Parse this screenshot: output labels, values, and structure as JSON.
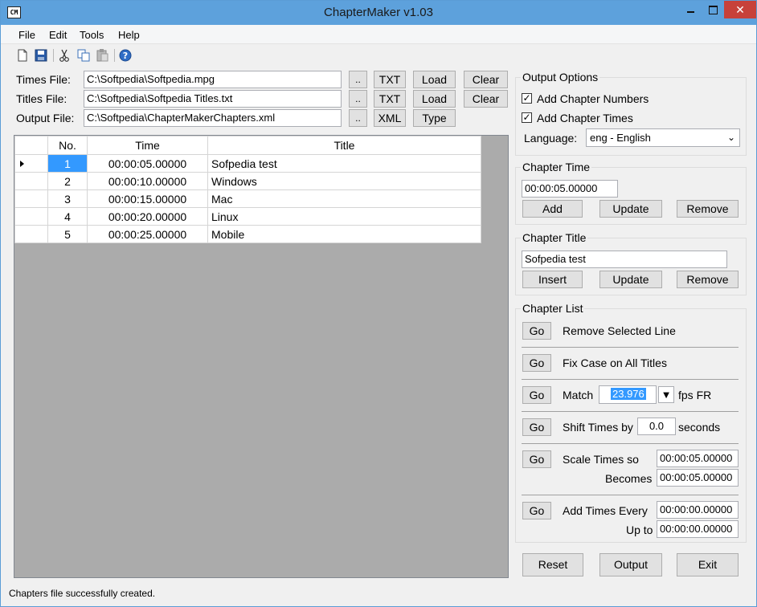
{
  "window": {
    "title": "ChapterMaker v1.03",
    "icon_label": "CM",
    "close_glyph": "✕"
  },
  "menu": [
    "File",
    "Edit",
    "Tools",
    "Help"
  ],
  "toolbar": {
    "icons": [
      "new-file-icon",
      "save-icon",
      "cut-icon",
      "copy-icon",
      "paste-icon",
      "help-icon"
    ]
  },
  "files": {
    "times_label": "Times File:",
    "times_value": "C:\\Softpedia\\Softpedia.mpg",
    "titles_label": "Titles File:",
    "titles_value": "C:\\Softpedia\\Softpedia Titles.txt",
    "output_label": "Output File:",
    "output_value": "C:\\Softpedia\\ChapterMakerChapters.xml",
    "browse_label": "..",
    "txt_label": "TXT",
    "xml_label": "XML",
    "load_label": "Load",
    "clear_label": "Clear",
    "type_label": "Type"
  },
  "grid": {
    "columns": [
      "No.",
      "Time",
      "Title"
    ],
    "rows": [
      {
        "no": "1",
        "time": "00:00:05.00000",
        "title": "Sofpedia test"
      },
      {
        "no": "2",
        "time": "00:00:10.00000",
        "title": "Windows"
      },
      {
        "no": "3",
        "time": "00:00:15.00000",
        "title": "Mac"
      },
      {
        "no": "4",
        "time": "00:00:20.00000",
        "title": "Linux"
      },
      {
        "no": "5",
        "time": "00:00:25.00000",
        "title": "Mobile"
      }
    ]
  },
  "output_options": {
    "title": "Output Options",
    "add_numbers_label": "Add Chapter Numbers",
    "add_numbers_checked": true,
    "add_times_label": "Add Chapter Times",
    "add_times_checked": true,
    "language_label": "Language:",
    "language_value": "eng - English"
  },
  "chapter_time": {
    "title": "Chapter Time",
    "value": "00:00:05.00000",
    "add_label": "Add",
    "update_label": "Update",
    "remove_label": "Remove"
  },
  "chapter_title": {
    "title": "Chapter Title",
    "value": "Sofpedia test",
    "insert_label": "Insert",
    "update_label": "Update",
    "remove_label": "Remove"
  },
  "chapter_list": {
    "title": "Chapter List",
    "go_label": "Go",
    "remove_selected_label": "Remove Selected Line",
    "fix_case_label": "Fix Case on All Titles",
    "match_label": "Match",
    "match_value": "23.976",
    "fps_label": "fps FR",
    "shift_label": "Shift Times by",
    "shift_value": "0.0",
    "seconds_label": "seconds",
    "scale_label": "Scale Times so",
    "scale_from": "00:00:05.00000",
    "becomes_label": "Becomes",
    "scale_to": "00:00:05.00000",
    "add_every_label": "Add Times Every",
    "add_every_value": "00:00:00.00000",
    "up_to_label": "Up to",
    "up_to_value": "00:00:00.00000"
  },
  "actions": {
    "reset_label": "Reset",
    "output_label": "Output",
    "exit_label": "Exit"
  },
  "status": {
    "text": "Chapters file successfully created."
  }
}
